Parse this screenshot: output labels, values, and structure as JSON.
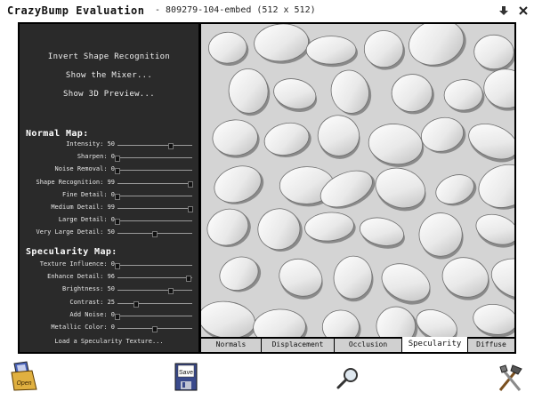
{
  "window": {
    "app_title": "CrazyBump Evaluation",
    "file_title": "- 809279-104-embed (512 x 512)"
  },
  "menu": {
    "invert_label": "Invert Shape Recognition",
    "mixer_label": "Show the Mixer...",
    "preview3d_label": "Show 3D Preview..."
  },
  "normal_map": {
    "title": "Normal Map:",
    "sliders": [
      {
        "label": "Intensity:",
        "value": "50",
        "fraction": 0.72
      },
      {
        "label": "Sharpen:",
        "value": "0",
        "fraction": 0.0
      },
      {
        "label": "Noise Removal:",
        "value": "0",
        "fraction": 0.0
      },
      {
        "label": "Shape Recognition:",
        "value": "99",
        "fraction": 0.98
      },
      {
        "label": "Fine Detail:",
        "value": "0",
        "fraction": 0.0
      },
      {
        "label": "Medium Detail:",
        "value": "99",
        "fraction": 0.98
      },
      {
        "label": "Large Detail:",
        "value": "0",
        "fraction": 0.0
      },
      {
        "label": "Very Large Detail:",
        "value": "50",
        "fraction": 0.5
      }
    ]
  },
  "specularity_map": {
    "title": "Specularity Map:",
    "sliders": [
      {
        "label": "Texture Influence:",
        "value": "0",
        "fraction": 0.0
      },
      {
        "label": "Enhance Detail:",
        "value": "96",
        "fraction": 0.95
      },
      {
        "label": "Brightness:",
        "value": "50",
        "fraction": 0.72
      },
      {
        "label": "Contrast:",
        "value": "25",
        "fraction": 0.25
      },
      {
        "label": "Add Noise:",
        "value": "0",
        "fraction": 0.0
      },
      {
        "label": "Metallic Color:",
        "value": "0",
        "fraction": 0.5
      }
    ],
    "load_texture_label": "Load a Specularity Texture..."
  },
  "tabs": [
    {
      "label": "Normals",
      "active": false
    },
    {
      "label": "Displacement",
      "active": false
    },
    {
      "label": "Occlusion",
      "active": false
    },
    {
      "label": "Specularity",
      "active": true
    },
    {
      "label": "Diffuse",
      "active": false
    }
  ],
  "toolbar": {
    "open_label": "Open",
    "save_label": "Save"
  },
  "icons": [
    "download-icon",
    "close-icon",
    "open-icon",
    "save-icon",
    "zoom-icon",
    "tools-icon"
  ]
}
